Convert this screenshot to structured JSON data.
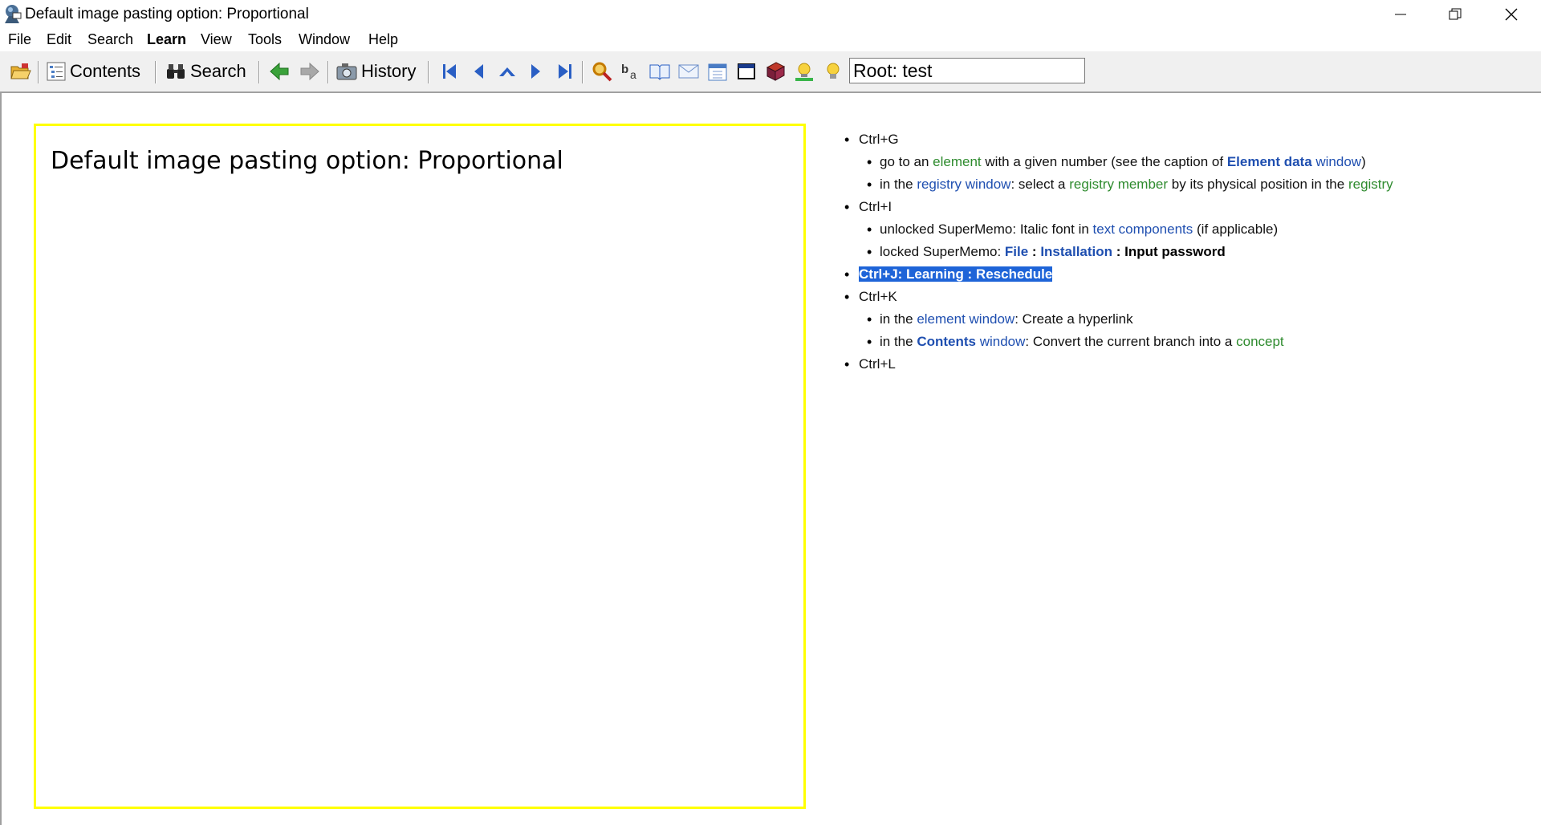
{
  "window": {
    "title": "Default image pasting option: Proportional",
    "controls": [
      "minimize",
      "restore",
      "close"
    ]
  },
  "menu": [
    "File",
    "Edit",
    "Search",
    "Learn",
    "View",
    "Tools",
    "Window",
    "Help"
  ],
  "toolbar": {
    "contents_label": "Contents",
    "search_label": "Search",
    "history_label": "History",
    "root_field": "Root: test"
  },
  "question": {
    "title": "Default image pasting option: Proportional"
  },
  "answer": {
    "g_key": "Ctrl+G",
    "g1": [
      "go to an ",
      "element",
      " with a given number (see the caption of ",
      "Element data",
      " window",
      ")"
    ],
    "g2": [
      "in the ",
      "registry window",
      ": select a ",
      "registry member",
      " by its physical position in the ",
      "registry"
    ],
    "i_key": "Ctrl+I",
    "i1": [
      "unlocked SuperMemo: Italic font in ",
      "text components",
      " (if applicable)"
    ],
    "i2": [
      "locked SuperMemo: ",
      "File",
      " : ",
      "Installation",
      " : Input password"
    ],
    "j_line": "Ctrl+J: Learning : Reschedule",
    "k_key": "Ctrl+K",
    "k1": [
      "in the ",
      "element window",
      ": Create a hyperlink"
    ],
    "k2": [
      "in the ",
      "Contents",
      " window",
      ": Convert the current branch into a ",
      "concept"
    ],
    "l_key": "Ctrl+L"
  },
  "colors": {
    "question_border": "#ffff00",
    "link_green": "#2e8b2e",
    "link_blue": "#1f4fb0",
    "selection": "#1e64d8"
  }
}
